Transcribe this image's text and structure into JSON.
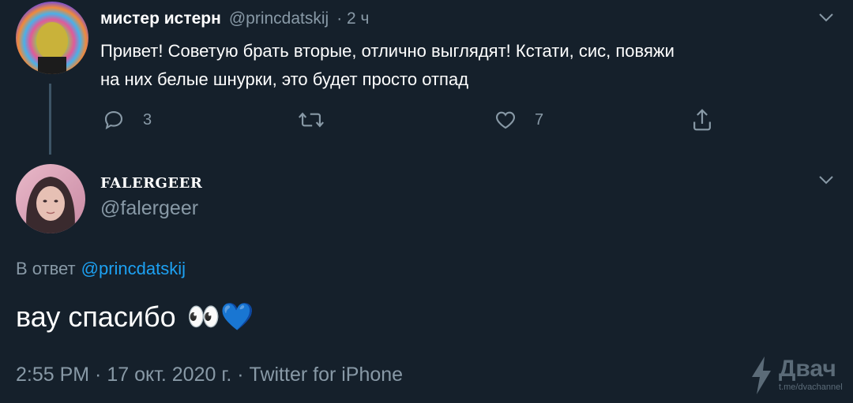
{
  "tweet1": {
    "display_name": "мистер истерн",
    "handle": "@princdatskij",
    "time": "· 2 ч",
    "text_line1": "Привет! Советую брать вторые, отлично выглядят! Кстати, сис, повяжи",
    "text_line2": "на них белые шнурки, это будет просто отпад",
    "replies": "3",
    "likes": "7"
  },
  "tweet2": {
    "display_name": "FALERGEER",
    "handle": "@falergeer",
    "reply_prefix": "В ответ",
    "reply_to": "@princdatskij",
    "text": "вау спасибо",
    "emoji": "👀💙",
    "meta": "2:55 PM · 17 окт. 2020 г. · Twitter for iPhone"
  },
  "watermark": {
    "brand": "Двач",
    "url": "t.me/dvachannel"
  },
  "colors": {
    "background": "#15202b",
    "muted": "#8899a6",
    "link": "#1da1f2"
  }
}
